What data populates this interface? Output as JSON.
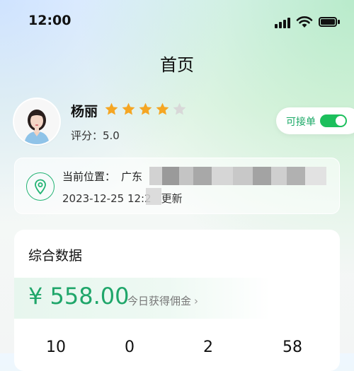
{
  "status_bar": {
    "time": "12:00",
    "icons": [
      "signal-icon",
      "wifi-icon",
      "battery-icon"
    ]
  },
  "page": {
    "title": "首页"
  },
  "profile": {
    "name": "杨丽",
    "stars_filled": 4,
    "stars_total": 5,
    "rating_text": "评分：5.0",
    "accept_label": "可接单",
    "accept_on": true
  },
  "location": {
    "label": "当前位置：",
    "value_visible": "广东",
    "updated": "2023-12-25 12:2",
    "updated_suffix": "更新"
  },
  "data": {
    "title": "综合数据",
    "earnings": "¥ 558.00",
    "earnings_label": "今日获得佣金",
    "stats": [
      "10",
      "0",
      "2",
      "58"
    ]
  },
  "colors": {
    "accent_green": "#1fa66a",
    "switch_green": "#1cbf5c",
    "star_gold": "#f5a623",
    "star_grey": "#d8d8d8"
  }
}
